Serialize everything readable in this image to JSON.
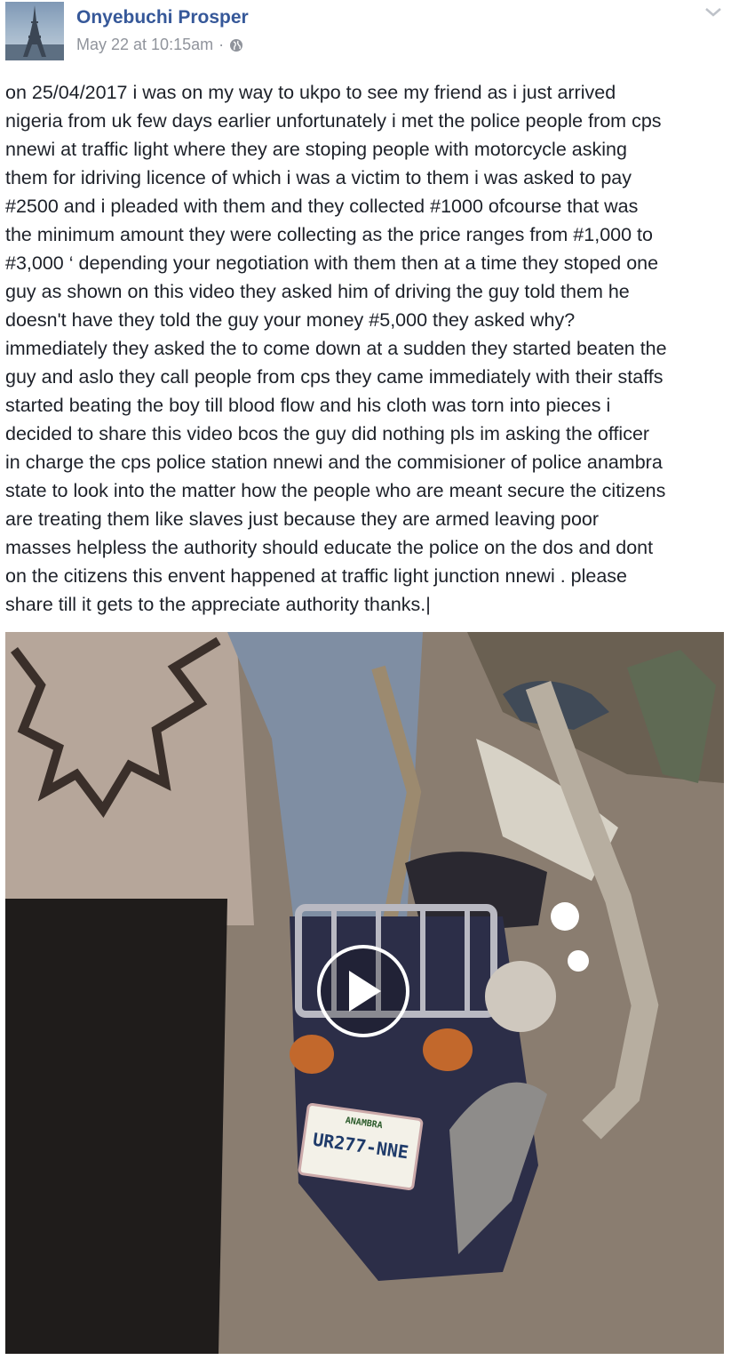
{
  "post": {
    "author": "Onyebuchi Prosper",
    "timestamp": "May 22 at 10:15am",
    "separator": "·",
    "audience_icon": "globe-icon",
    "menu_icon": "chevron-down-icon",
    "text": "on 25/04/2017 i was on my way to ukpo to see my friend as i just arrived\nnigeria from uk few days earlier unfortunately i met the police people from cps\nnnewi at traffic light where they are stoping people with motorcycle asking\nthem for idriving licence of which i was a victim to them i was asked to pay\n#2500 and i pleaded with them and they collected #1000 ofcourse that was\nthe minimum amount they were collecting as the price ranges from #1,000 to\n#3,000 ‘ depending your negotiation with them then at a time they stoped one\nguy as shown on this video they asked him of driving the guy told them he\ndoesn't have they told the guy your money #5,000 they asked why?\nimmediately they asked the to come down at a sudden they started beaten the\nguy and aslo they call people from cps they came immediately with their staffs\nstarted beating the boy till blood flow and his cloth was torn into pieces i\ndecided to share this video bcos the guy did nothing pls im asking the officer\nin charge the cps police station nnewi and the commisioner of police anambra\nstate to look into the matter how the people who are meant secure the citizens\nare treating them like slaves just because they are armed leaving poor\nmasses helpless the authority should educate the police on the dos and dont\non the citizens this envent happened at traffic light junction nnewi . please\nshare till it gets to the appreciate authority thanks.|"
  },
  "video": {
    "play_icon": "play-icon",
    "plate_text": "UR277-NNE",
    "plate_state": "ANAMBRA"
  },
  "colors": {
    "author": "#365899",
    "meta": "#90949c",
    "text": "#1d2129"
  }
}
